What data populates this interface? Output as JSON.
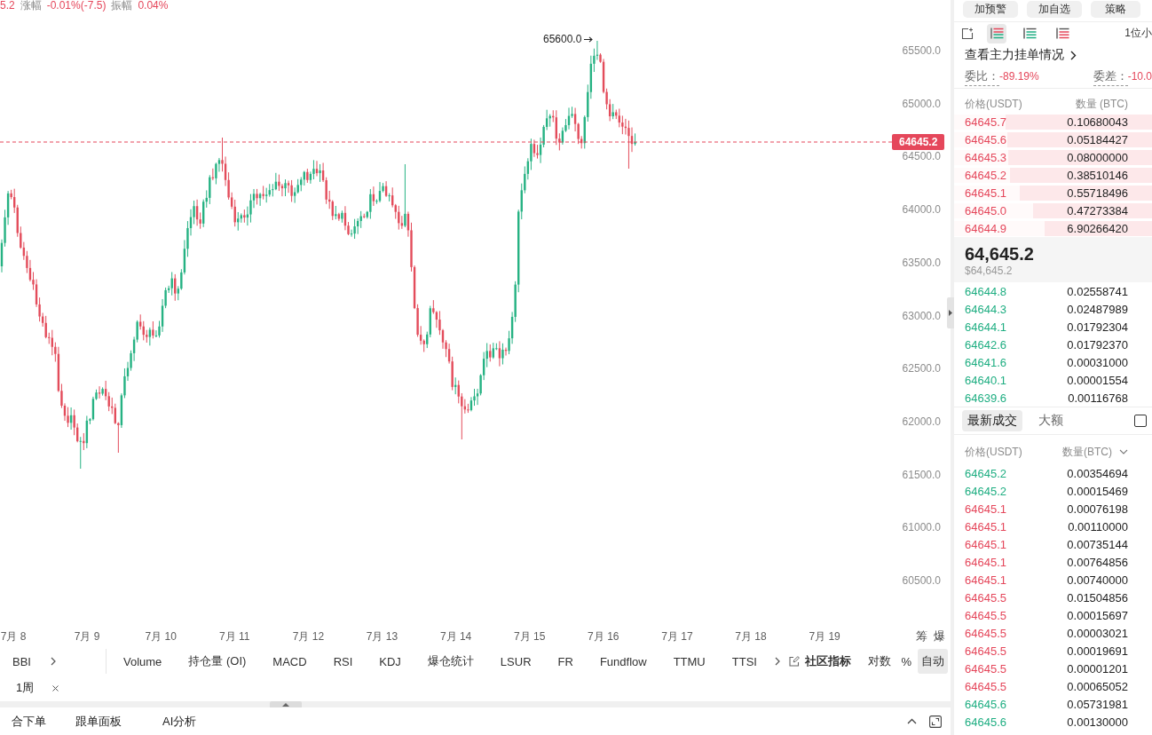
{
  "quote_header": [
    {
      "kind": "value",
      "text": "5.2"
    },
    {
      "kind": "label",
      "text": "涨幅"
    },
    {
      "kind": "value",
      "text": "-0.01%(-7.5)"
    },
    {
      "kind": "label",
      "text": "振幅"
    },
    {
      "kind": "value",
      "text": "0.04%"
    }
  ],
  "chart": {
    "high_marker": "65600.0",
    "last_price": "64645.2",
    "price_axis": [
      "65500.0",
      "65000.0",
      "64500.0",
      "64000.0",
      "63500.0",
      "63000.0",
      "62500.0",
      "62000.0",
      "61500.0",
      "61000.0",
      "60500.0"
    ],
    "date_axis": [
      "7月 8",
      "7月 9",
      "7月 10",
      "7月 11",
      "7月 12",
      "7月 13",
      "7月 14",
      "7月 15",
      "7月 16",
      "7月 17",
      "7月 18",
      "7月 19"
    ],
    "axis_buttons": [
      "筹",
      "爆"
    ]
  },
  "indicator_bar": {
    "main": [
      "BBI"
    ],
    "sub": [
      "Volume",
      "持仓量 (OI)",
      "MACD",
      "RSI",
      "KDJ",
      "爆仓统计",
      "LSUR",
      "FR",
      "Fundflow",
      "TTMU",
      "TTSI"
    ],
    "community": "社区指标",
    "scale_options": [
      {
        "label": "对数",
        "selected": false
      },
      {
        "label": "%",
        "selected": false
      },
      {
        "label": "自动",
        "selected": true
      }
    ]
  },
  "interval_tag": "1周",
  "bottom_tabs": [
    "合下单",
    "跟单面板",
    "AI分析"
  ],
  "side_panel": {
    "actions": [
      "加预警",
      "加自选",
      "策略"
    ],
    "views": [
      {
        "kind": "both",
        "selected": true
      },
      {
        "kind": "bids",
        "selected": false
      },
      {
        "kind": "asks",
        "selected": false
      }
    ],
    "precision": "1位小",
    "main_orders_link": "查看主力挂单情况",
    "ratio": {
      "label": "委比：",
      "value": "-89.19%"
    },
    "diff": {
      "label": "委差：",
      "value": "-10.0"
    },
    "book_columns": [
      "价格(USDT)",
      "数量 (BTC)"
    ],
    "asks": [
      {
        "price": "64645.7",
        "amount": "0.10680043",
        "level": 0.74
      },
      {
        "price": "64645.6",
        "amount": "0.05184427",
        "level": 0.73
      },
      {
        "price": "64645.3",
        "amount": "0.08000000",
        "level": 0.726
      },
      {
        "price": "64645.2",
        "amount": "0.38510146",
        "level": 0.717
      },
      {
        "price": "64645.1",
        "amount": "0.55718496",
        "level": 0.668
      },
      {
        "price": "64645.0",
        "amount": "0.47273384",
        "level": 0.601
      },
      {
        "price": "64644.9",
        "amount": "6.90266420",
        "level": 0.543
      }
    ],
    "mid_price": "64,645.2",
    "mid_price_usd": "$64,645.2",
    "bids": [
      {
        "price": "64644.8",
        "amount": "0.02558741"
      },
      {
        "price": "64644.3",
        "amount": "0.02487989"
      },
      {
        "price": "64644.1",
        "amount": "0.01792304"
      },
      {
        "price": "64642.6",
        "amount": "0.01792370"
      },
      {
        "price": "64641.6",
        "amount": "0.00031000"
      },
      {
        "price": "64640.1",
        "amount": "0.00001554"
      },
      {
        "price": "64639.6",
        "amount": "0.00116768"
      }
    ],
    "trade_tabs": [
      {
        "label": "最新成交",
        "selected": true
      },
      {
        "label": "大额",
        "selected": false
      }
    ],
    "filter_checkbox": {
      "checked": false
    },
    "trade_columns": [
      "价格(USDT)",
      "数量(BTC)"
    ],
    "trades": [
      {
        "price": "64645.2",
        "amount": "0.00354694",
        "color": "#1fae82"
      },
      {
        "price": "64645.2",
        "amount": "0.00015469",
        "color": "#1fae82"
      },
      {
        "price": "64645.1",
        "amount": "0.00076198",
        "color": "#e5475b"
      },
      {
        "price": "64645.1",
        "amount": "0.00110000",
        "color": "#e5475b"
      },
      {
        "price": "64645.1",
        "amount": "0.00735144",
        "color": "#e5475b"
      },
      {
        "price": "64645.1",
        "amount": "0.00764856",
        "color": "#e5475b"
      },
      {
        "price": "64645.1",
        "amount": "0.00740000",
        "color": "#e5475b"
      },
      {
        "price": "64645.5",
        "amount": "0.01504856",
        "color": "#e5475b"
      },
      {
        "price": "64645.5",
        "amount": "0.00015697",
        "color": "#e5475b"
      },
      {
        "price": "64645.5",
        "amount": "0.00003021",
        "color": "#e5475b"
      },
      {
        "price": "64645.5",
        "amount": "0.00019691",
        "color": "#e5475b"
      },
      {
        "price": "64645.5",
        "amount": "0.00001201",
        "color": "#e5475b"
      },
      {
        "price": "64645.5",
        "amount": "0.00065052",
        "color": "#e5475b"
      },
      {
        "price": "64645.6",
        "amount": "0.05731981",
        "color": "#1fae82"
      },
      {
        "price": "64645.6",
        "amount": "0.00130000",
        "color": "#1fae82"
      }
    ]
  }
}
